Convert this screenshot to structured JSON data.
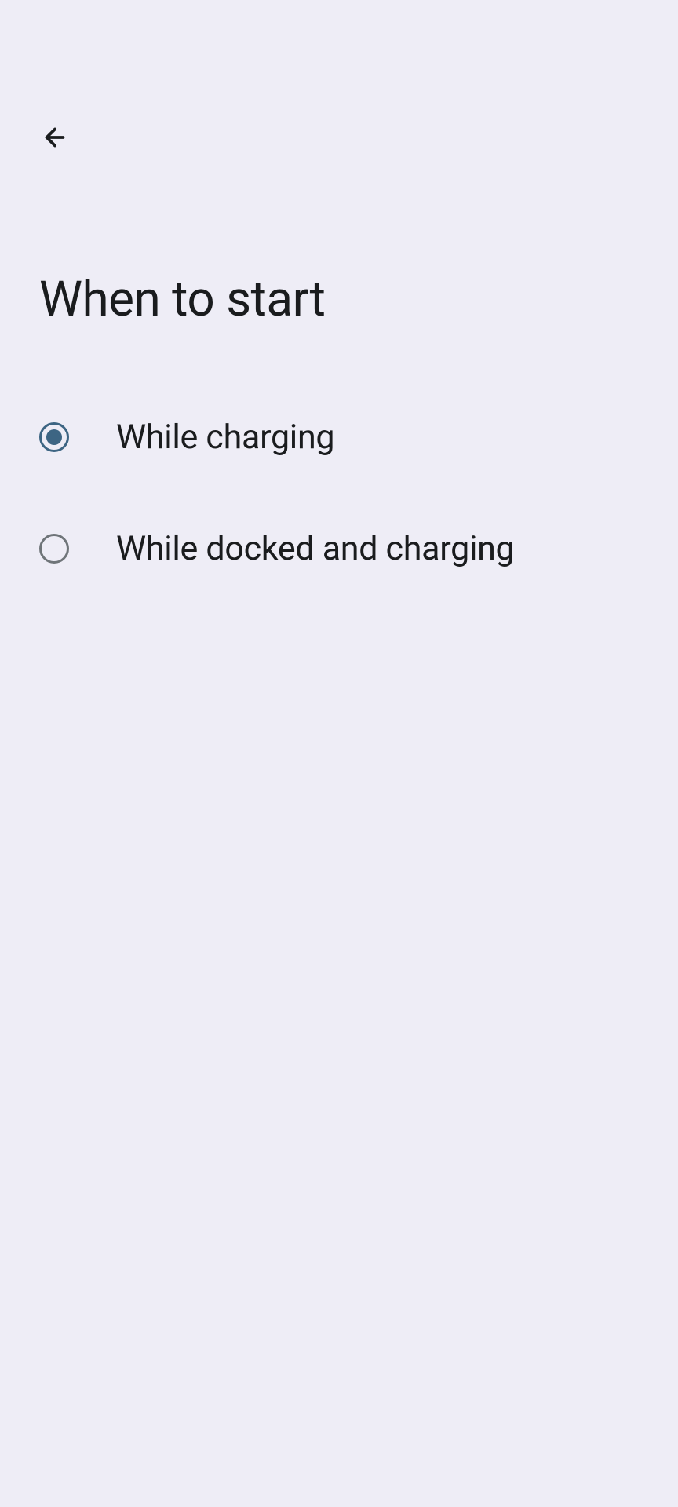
{
  "header": {
    "title": "When to start"
  },
  "options": [
    {
      "label": "While charging",
      "selected": true
    },
    {
      "label": "While docked and charging",
      "selected": false
    }
  ]
}
